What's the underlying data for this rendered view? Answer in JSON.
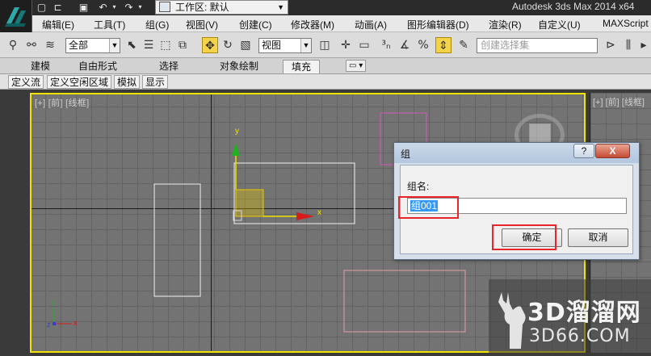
{
  "title_bar": {
    "workspace_label": "工作区: 默认",
    "app_title": "Autodesk 3ds Max  2014 x64"
  },
  "menu": [
    "编辑(E)",
    "工具(T)",
    "组(G)",
    "视图(V)",
    "创建(C)",
    "修改器(M)",
    "动画(A)",
    "图形编辑器(D)",
    "渲染(R)",
    "自定义(U)",
    "MAXScript"
  ],
  "toolbar": {
    "selection_filter": "全部",
    "reference_coord": "视图",
    "named_selection_placeholder": "创建选择集"
  },
  "ribbon_tabs": [
    "建模",
    "自由形式",
    "选择",
    "对象绘制",
    "填充"
  ],
  "ribbon_active": "填充",
  "sub_tabs": [
    "定义流",
    "定义空闲区域",
    "模拟",
    "显示"
  ],
  "viewport": {
    "label": "[+] [前] [线框]",
    "right_label": "[+] [前] [线框]",
    "gizmo_x": "x",
    "gizmo_y": "y",
    "corner_y": "y",
    "corner_z": "z",
    "corner_x": "x"
  },
  "dialog": {
    "title": "组",
    "help_label": "?",
    "close_label": "X",
    "field_label": "组名:",
    "field_value": "组001",
    "ok_label": "确定",
    "cancel_label": "取消"
  },
  "watermark": {
    "title": "3D溜溜网",
    "url": "3D66.COM"
  },
  "colors": {
    "viewport_border": "#f1e300",
    "highlight_red": "#e8262a",
    "selection_blue": "#3399ff"
  }
}
